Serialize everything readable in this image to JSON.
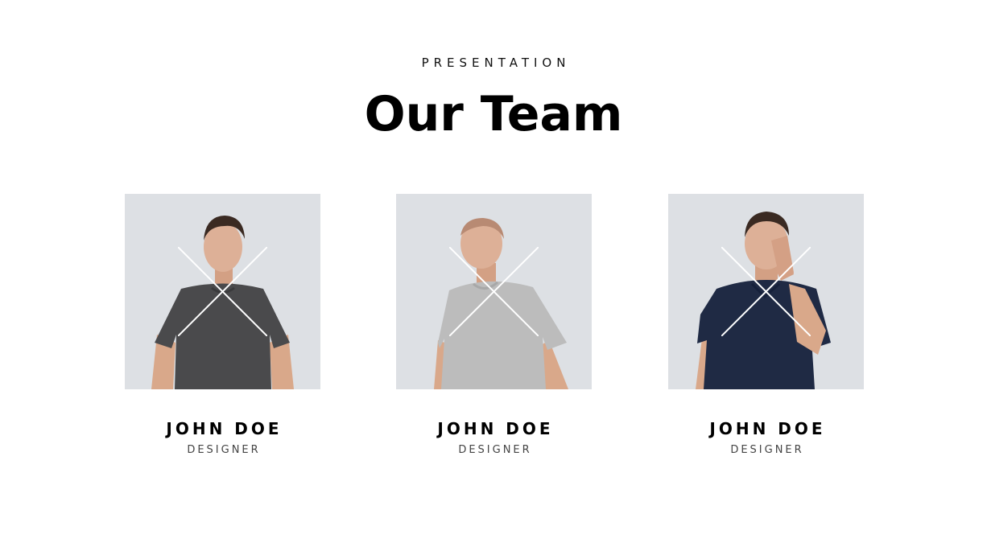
{
  "header": {
    "eyebrow": "PRESENTATION",
    "title": "Our Team"
  },
  "colors": {
    "photo_background": "#dde0e4",
    "placeholder_cross": "#ffffff",
    "skin": "#d9a88a",
    "hair_dark": "#3a2a22"
  },
  "team": [
    {
      "name": "JOHN DOE",
      "role": "DESIGNER",
      "shirt_color": "#4a4a4c",
      "icon": "placeholder-x-icon"
    },
    {
      "name": "JOHN DOE",
      "role": "DESIGNER",
      "shirt_color": "#b9b9b9",
      "icon": "placeholder-x-icon"
    },
    {
      "name": "JOHN DOE",
      "role": "DESIGNER",
      "shirt_color": "#1f2a44",
      "icon": "placeholder-x-icon"
    }
  ]
}
